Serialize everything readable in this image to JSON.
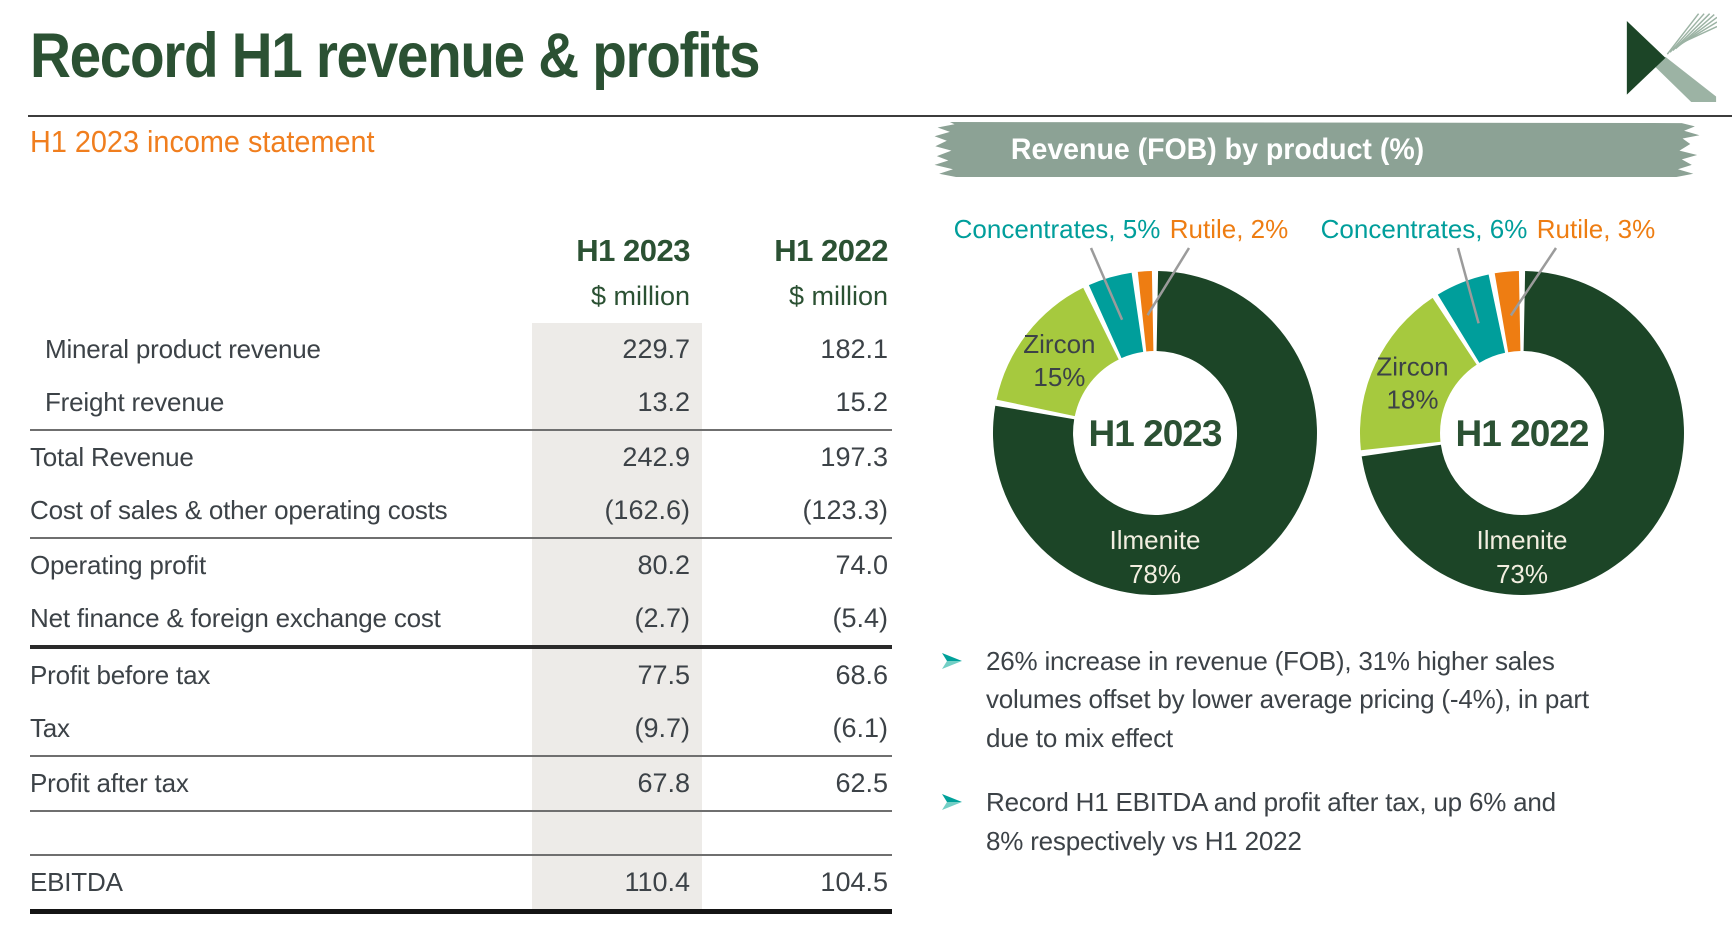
{
  "header": {
    "title": "Record H1 revenue & profits",
    "subtitle": "H1 2023 income statement",
    "logo": "kenmare-k-logo"
  },
  "table": {
    "columns": [
      {
        "label": "H1 2023",
        "unit": "$ million",
        "highlighted": true
      },
      {
        "label": "H1 2022",
        "unit": "$ million",
        "highlighted": false
      }
    ],
    "rows": [
      {
        "label": "Mineral product revenue",
        "values": [
          "229.7",
          "182.1"
        ],
        "indent": true
      },
      {
        "label": "Freight revenue",
        "values": [
          "13.2",
          "15.2"
        ],
        "indent": true,
        "rule_after": "thin"
      },
      {
        "label": "Total Revenue",
        "values": [
          "242.9",
          "197.3"
        ]
      },
      {
        "label": "Cost of sales & other operating costs",
        "values": [
          "(162.6)",
          "(123.3)"
        ],
        "rule_after": "thin"
      },
      {
        "label": "Operating profit",
        "values": [
          "80.2",
          "74.0"
        ]
      },
      {
        "label": "Net finance & foreign exchange cost",
        "values": [
          "(2.7)",
          "(5.4)"
        ],
        "rule_after": "medium"
      },
      {
        "label": "Profit before tax",
        "values": [
          "77.5",
          "68.6"
        ]
      },
      {
        "label": "Tax",
        "values": [
          "(9.7)",
          "(6.1)"
        ],
        "rule_after": "thin"
      },
      {
        "label": "Profit after tax",
        "values": [
          "67.8",
          "62.5"
        ],
        "rule_after": "thin"
      },
      {
        "label": "",
        "values": [
          "",
          ""
        ],
        "spacer": true,
        "rule_after": "thin"
      },
      {
        "label": "EBITDA",
        "values": [
          "110.4",
          "104.5"
        ],
        "rule_after": "thick"
      }
    ]
  },
  "panel": {
    "banner_title": "Revenue (FOB) by product (%)"
  },
  "chart_data": [
    {
      "type": "pie",
      "donut": true,
      "title": "H1 2023",
      "center_label": "H1 2023",
      "unit": "%",
      "categories": [
        "Ilmenite",
        "Zircon",
        "Concentrates",
        "Rutile"
      ],
      "values": [
        78,
        15,
        5,
        2
      ],
      "colors": [
        "#1c4527",
        "#a6c93e",
        "#009e9b",
        "#ee7d12"
      ],
      "label_styles": [
        "inside-light",
        "inside-dark",
        "callout",
        "callout"
      ]
    },
    {
      "type": "pie",
      "donut": true,
      "title": "H1 2022",
      "center_label": "H1 2022",
      "unit": "%",
      "categories": [
        "Ilmenite",
        "Zircon",
        "Concentrates",
        "Rutile"
      ],
      "values": [
        73,
        18,
        6,
        3
      ],
      "colors": [
        "#1c4527",
        "#a6c93e",
        "#009e9b",
        "#ee7d12"
      ],
      "label_styles": [
        "inside-light",
        "inside-dark",
        "callout",
        "callout"
      ]
    }
  ],
  "bullets": [
    {
      "text": "26% increase in revenue (FOB), 31% higher sales volumes offset by lower average pricing (-4%), in part due to mix effect"
    },
    {
      "text": "Record H1 EBITDA and profit after tax, up 6% and 8% respectively vs H1 2022"
    }
  ],
  "colors": {
    "accent_green": "#2b5133",
    "accent_orange": "#f07e1e",
    "banner_sage": "#8ca295",
    "table_band_gray": "#edebe8",
    "body_text": "#3c4247",
    "ilmenite": "#1c4527",
    "zircon": "#a6c93e",
    "concentrates": "#009e9b",
    "rutile": "#ee7d12",
    "bullet_teal": "#00a19a"
  }
}
